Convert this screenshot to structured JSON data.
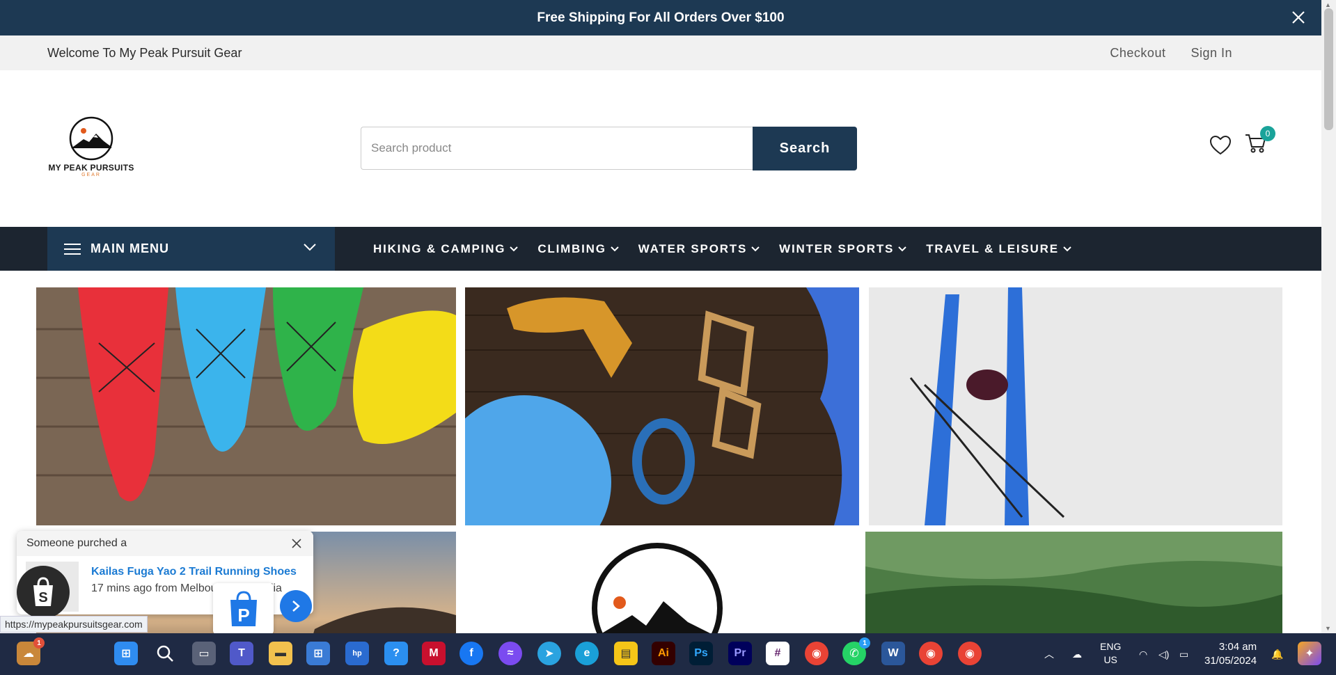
{
  "announcement": {
    "text": "Free Shipping For All Orders Over $100",
    "close_icon": "close-icon"
  },
  "topbar": {
    "welcome": "Welcome To My Peak Pursuit Gear",
    "checkout": "Checkout",
    "sign_in": "Sign In"
  },
  "logo": {
    "brand": "MY PEAK PURSUITS",
    "sub": "GEAR"
  },
  "search": {
    "placeholder": "Search product",
    "button": "Search"
  },
  "header_icons": {
    "wishlist": "heart-icon",
    "cart": "cart-icon",
    "cart_count": "0"
  },
  "nav": {
    "main_menu": "MAIN MENU",
    "items": [
      "HIKING & CAMPING",
      "CLIMBING",
      "WATER SPORTS",
      "WINTER SPORTS",
      "TRAVEL & LEISURE"
    ]
  },
  "tiles": [
    {
      "name": "kayaks-image"
    },
    {
      "name": "climbing-gear-image"
    },
    {
      "name": "skis-image"
    },
    {
      "name": "sunset-landscape-image"
    },
    {
      "name": "logo-tile-image"
    },
    {
      "name": "forest-hills-image"
    }
  ],
  "popup": {
    "header": "Someone purched a",
    "product": "Kailas Fuga Yao 2 Trail Running Shoes",
    "meta": "17 mins ago from Melbourne, Australia"
  },
  "status_url": "https://mypeakpursuitsgear.com",
  "taskbar": {
    "lang_1": "ENG",
    "lang_2": "US",
    "time": "3:04 am",
    "date": "31/05/2024",
    "weather_badge": "1",
    "whatsapp_badge": "1"
  },
  "colors": {
    "navy": "#1d3953",
    "nav_dark": "#1c2530",
    "teal_badge": "#1aa39a",
    "link_blue": "#1c7bd3"
  }
}
